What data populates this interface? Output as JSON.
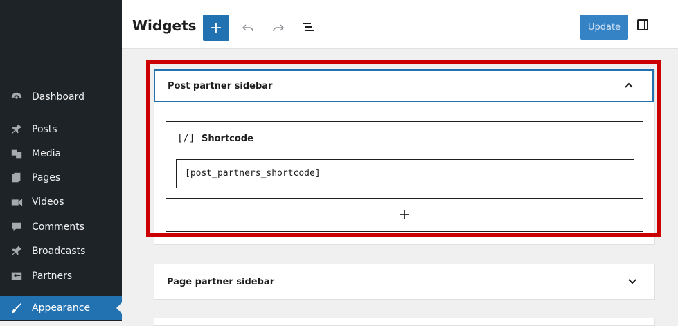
{
  "header": {
    "title": "Widgets",
    "add_label": "+",
    "update_label": "Update"
  },
  "sidebar": {
    "items": [
      {
        "label": "Dashboard",
        "icon": "dashboard-icon"
      },
      {
        "label": "Posts",
        "icon": "pin-icon"
      },
      {
        "label": "Media",
        "icon": "media-icon"
      },
      {
        "label": "Pages",
        "icon": "pages-icon"
      },
      {
        "label": "Videos",
        "icon": "video-icon"
      },
      {
        "label": "Comments",
        "icon": "comment-icon"
      },
      {
        "label": "Broadcasts",
        "icon": "pin-icon"
      },
      {
        "label": "Partners",
        "icon": "partners-icon"
      },
      {
        "label": "Appearance",
        "icon": "brush-icon"
      }
    ],
    "active": "Appearance"
  },
  "areas": [
    {
      "title": "Post partner sidebar",
      "expanded": true,
      "block": {
        "icon": "[/]",
        "name": "Shortcode",
        "value": "[post_partners_shortcode]"
      },
      "appender_label": "+"
    },
    {
      "title": "Page partner sidebar",
      "expanded": false
    }
  ],
  "colors": {
    "accent": "#2271b1",
    "highlight": "#cc0000",
    "sidebar_bg": "#1d2327"
  }
}
